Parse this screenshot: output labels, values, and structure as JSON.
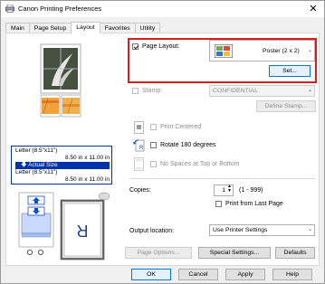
{
  "window": {
    "title": "Canon                  Printing Preferences",
    "close_label": "✕"
  },
  "tabs": [
    {
      "label": "Main"
    },
    {
      "label": "Page Setup"
    },
    {
      "label": "Layout"
    },
    {
      "label": "Favorites"
    },
    {
      "label": "Utility"
    }
  ],
  "left_panel": {
    "paper_label_1": "Letter (8.5\"x11\")",
    "paper_size_1": "8.50 in x 11.00 in",
    "actual_size": "Actual Size",
    "paper_label_2": "Letter (8.5\"x11\")",
    "paper_size_2": "8.50 in x 11.00 in"
  },
  "page_layout": {
    "label": "Page Layout:",
    "checked": true,
    "selected": "Poster (2 x 2)",
    "set_button": "Set..."
  },
  "stamp": {
    "label": "Stamp:",
    "selected": "CONFIDENTIAL",
    "define_button": "Define Stamp..."
  },
  "options": {
    "print_centered": "Print Centered",
    "rotate_180": "Rotate 180 degrees",
    "no_spaces": "No Spaces at Top or Bottom"
  },
  "copies": {
    "label": "Copies:",
    "value": "1",
    "range": "(1 - 999)",
    "print_from_last": "Print from Last Page"
  },
  "output": {
    "label": "Output location:",
    "selected": "Use Printer Settings"
  },
  "buttons": {
    "page_options": "Page Options...",
    "special_settings": "Special Settings...",
    "defaults": "Defaults",
    "ok": "OK",
    "cancel": "Cancel",
    "apply": "Apply",
    "help": "Help"
  },
  "colors": {
    "accent_blue": "#0033aa",
    "highlight_red": "#d81d1d",
    "poster_orange": "#f2a23a"
  }
}
